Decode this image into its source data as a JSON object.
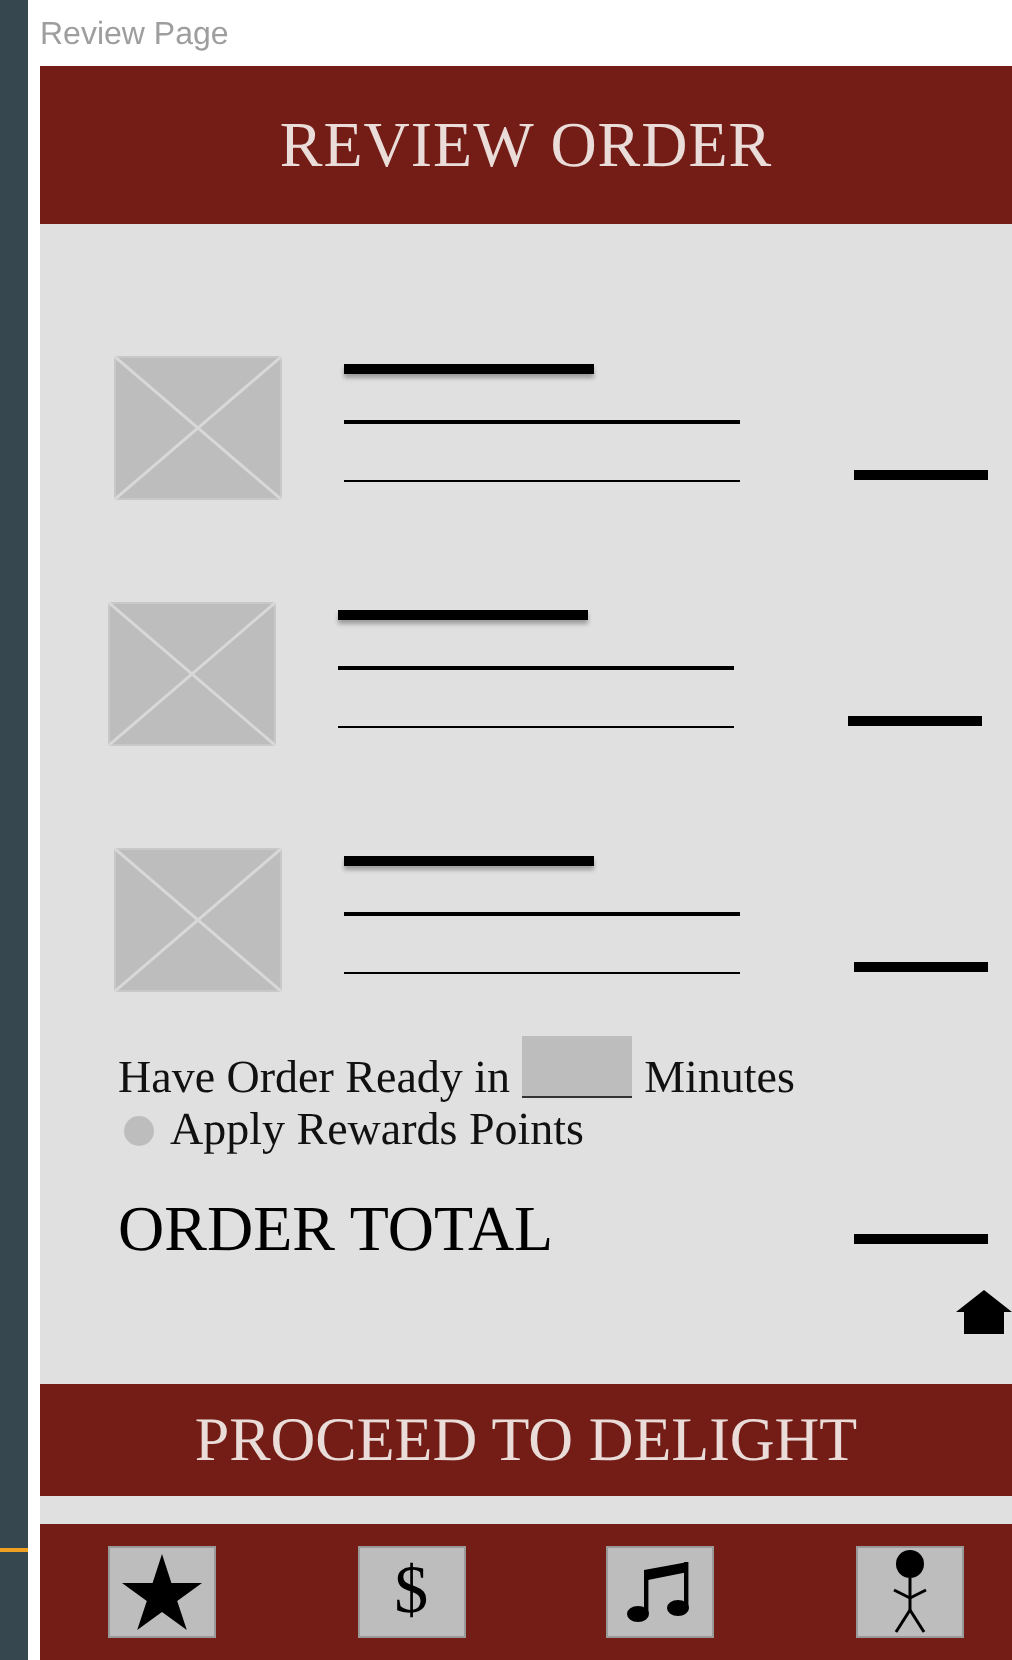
{
  "window": {
    "title": "Review Page"
  },
  "header": {
    "title": "REVIEW ORDER"
  },
  "items": [
    {
      "kind": "placeholder"
    },
    {
      "kind": "placeholder"
    },
    {
      "kind": "placeholder"
    }
  ],
  "ready": {
    "prefix": "Have Order Ready  in",
    "suffix": "Minutes"
  },
  "rewards": {
    "label": "Apply Rewards Points",
    "checked": false
  },
  "total": {
    "label": "ORDER TOTAL"
  },
  "proceed": {
    "label": "PROCEED TO DELIGHT"
  },
  "nav": [
    {
      "kind": "star"
    },
    {
      "kind": "text",
      "label": "$"
    },
    {
      "kind": "music"
    },
    {
      "kind": "person"
    }
  ]
}
